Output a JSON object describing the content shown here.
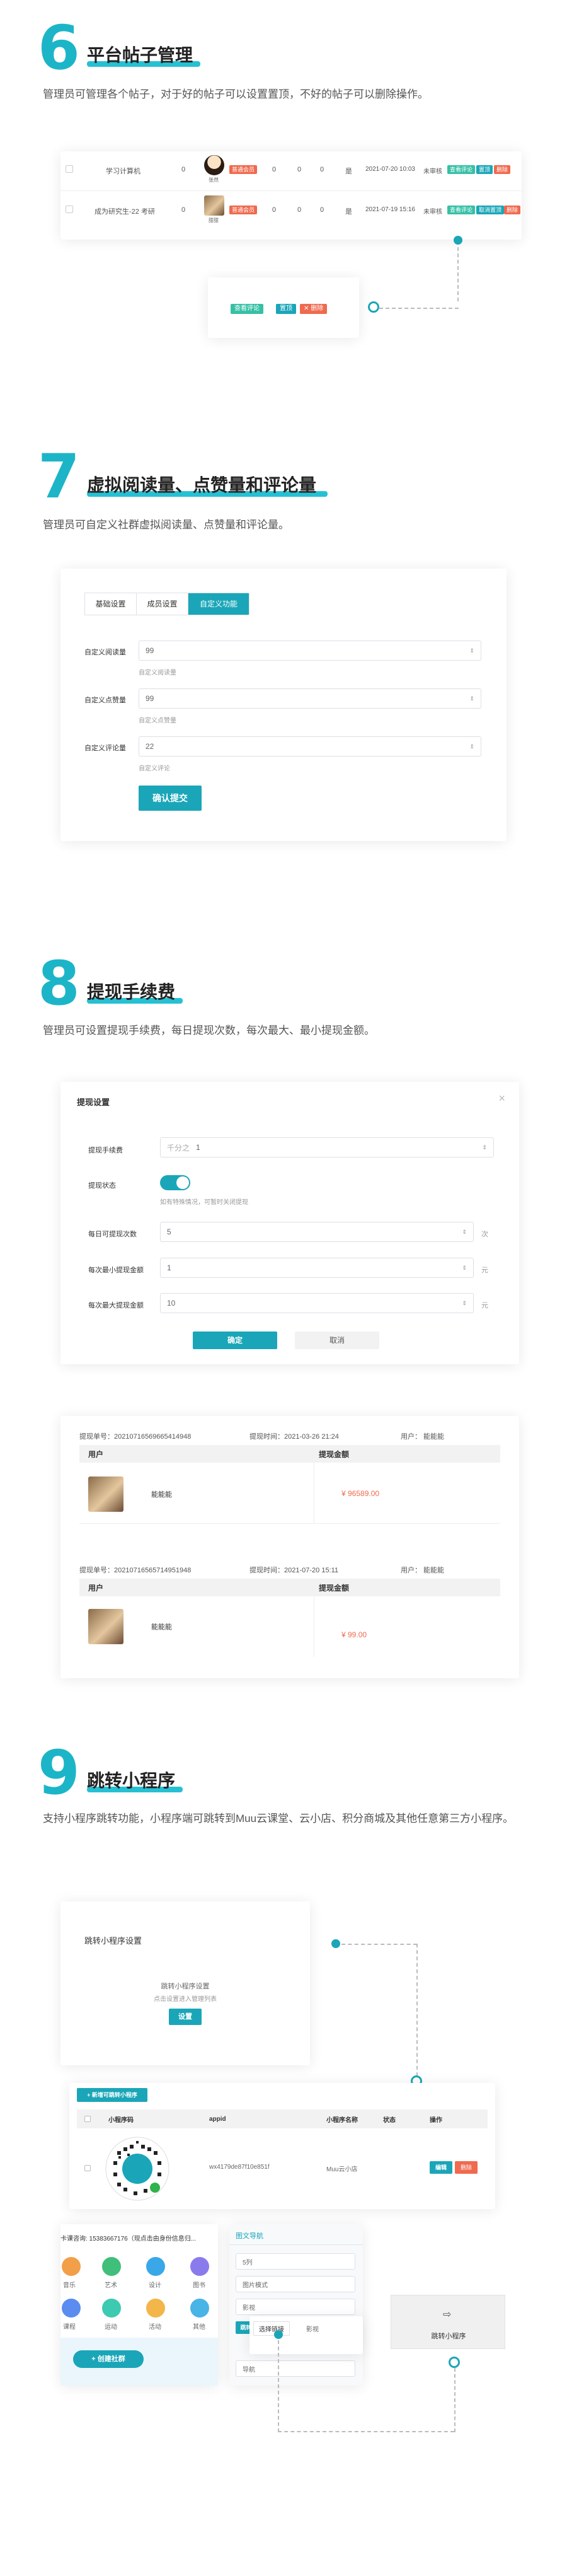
{
  "sections": [
    {
      "num": "6",
      "title": "平台帖子管理",
      "desc": "管理员可管理各个帖子，对于好的帖子可以设置置顶，不好的帖子可以删除操作。"
    },
    {
      "num": "7",
      "title": "虚拟阅读量、点赞量和评论量",
      "desc": "管理员可自定义社群虚拟阅读量、点赞量和评论量。"
    },
    {
      "num": "8",
      "title": "提现手续费",
      "desc": "管理员可设置提现手续费，每日提现次数，每次最大、最小提现金额。"
    },
    {
      "num": "9",
      "title": "跳转小程序",
      "desc": "支持小程序跳转功能，小程序端可跳转到Muu云课堂、云小店、积分商城及其他任意第三方小程序。"
    }
  ],
  "posts": [
    {
      "title": "学习计算机",
      "c1": "0",
      "author": "张然",
      "tag": "普通会员",
      "c2": "0",
      "c3": "0",
      "c4": "0",
      "status": "是",
      "time": "2021-07-20 10:03",
      "state": "未审核"
    },
    {
      "title": "成为研究生-22 考研",
      "c1": "0",
      "author": "甜甜",
      "tag": "普通会员",
      "c2": "0",
      "c3": "0",
      "c4": "0",
      "status": "是",
      "time": "2021-07-19 15:16",
      "state": "未审核"
    }
  ],
  "post_actions": {
    "review": "查看评论",
    "top": "置顶",
    "top2": "取消置顶",
    "del": "删除"
  },
  "post_popup": {
    "review": "查看评论",
    "top": "置顶",
    "del": "✕ 删除"
  },
  "virtual": {
    "tabs": [
      "基础设置",
      "成员设置",
      "自定义功能"
    ],
    "fields": [
      {
        "label": "自定义阅读量",
        "value": "99",
        "hint": "自定义阅读量"
      },
      {
        "label": "自定义点赞量",
        "value": "99",
        "hint": "自定义点赞量"
      },
      {
        "label": "自定义评论量",
        "value": "22",
        "hint": "自定义评论"
      }
    ],
    "submit": "确认提交"
  },
  "withdraw": {
    "title": "提现设置",
    "close": "×",
    "fee_label": "提现手续费",
    "fee_prefix": "千分之",
    "fee_value": "1",
    "status_label": "提现状态",
    "status_hint": "如有特殊情况，可暂时关闭提现",
    "daily_label": "每日可提现次数",
    "daily_value": "5",
    "daily_unit": "次",
    "min_label": "每次最小提现金额",
    "min_value": "1",
    "min_unit": "元",
    "max_label": "每次最大提现金额",
    "max_value": "10",
    "max_unit": "元",
    "ok": "确定",
    "cancel": "取消"
  },
  "records": [
    {
      "no": "提现单号：20210716569665414948",
      "time": "提现时间：2021-03-26 21:24",
      "user": "用户：  能能能",
      "col1": "用户",
      "col2": "提现金额",
      "name": "能能能",
      "amount": "¥ 96589.00"
    },
    {
      "no": "提现单号：20210716565714951948",
      "time": "提现时间：2021-07-20 15:11",
      "user": "用户：  能能能",
      "col1": "用户",
      "col2": "提现金额",
      "name": "能能能",
      "amount": "¥ 99.00"
    }
  ],
  "mini": {
    "card_title": "跳转小程序设置",
    "card_line1": "跳转小程序设置",
    "card_line2": "点击设置进入管理列表",
    "card_btn": "设置",
    "add_btn": "+ 新增可跳转小程序",
    "cols": [
      "小程序码",
      "appid",
      "小程序名称",
      "状态",
      "操作"
    ],
    "row": {
      "appid": "wx4179de87f10e851f",
      "name": "Muu云小店",
      "edit": "编辑",
      "del": "删除"
    },
    "phone_top": "卡课咨询: 15383667176（现点击由身份信息归...",
    "phone_icons": [
      "音乐",
      "艺术",
      "设计",
      "图书",
      "课程",
      "运动",
      "活动",
      "其他"
    ],
    "phone_btn": "+ 创建社群",
    "nav_title": "图文导航",
    "nav_items": [
      "5列",
      "图片模式",
      "影视",
      "导航"
    ],
    "nav_pick": "选择链接",
    "nav_tab": "跳转小程序",
    "jump_label": "跳转小程序"
  },
  "colors": {
    "accent": "#1aa6b8",
    "red": "#ef6a4e",
    "green": "#36c0a6"
  }
}
